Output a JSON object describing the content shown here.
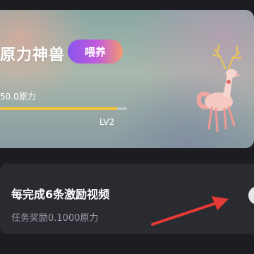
{
  "pet_card": {
    "name": "原力神兽",
    "feed_button": "喂养",
    "power_value": "50.0原力",
    "progress": 0.92,
    "level": "LV2",
    "accent_color": "#f3c33a"
  },
  "task": {
    "title": "每完成6条激励视频",
    "reward": "任务奖励0.1000原力"
  },
  "annotation": {
    "arrow_color": "#e53935"
  }
}
